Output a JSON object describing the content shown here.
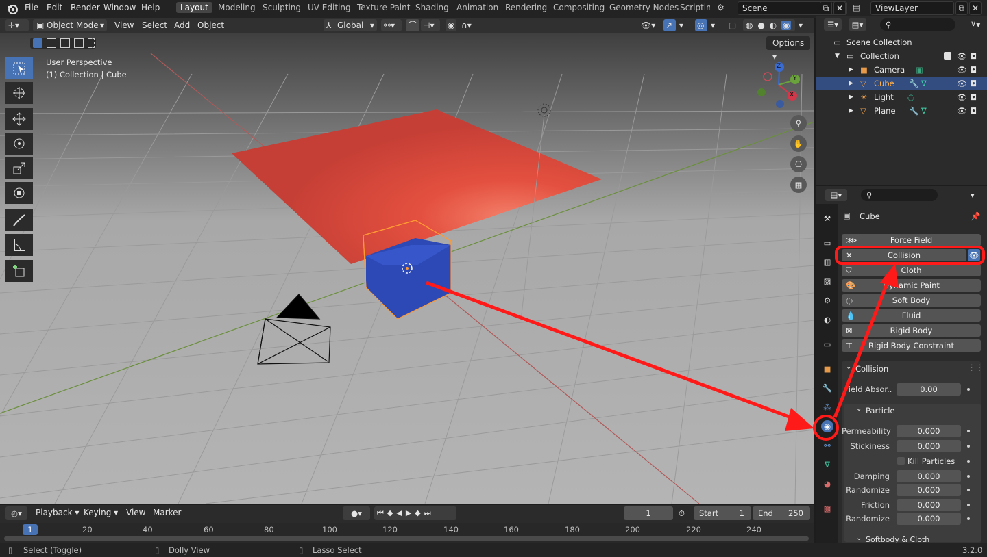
{
  "topbar": {
    "menus": [
      "File",
      "Edit",
      "Render",
      "Window",
      "Help"
    ],
    "workspaces": [
      "Layout",
      "Modeling",
      "Sculpting",
      "UV Editing",
      "Texture Paint",
      "Shading",
      "Animation",
      "Rendering",
      "Compositing",
      "Geometry Nodes",
      "Scripting"
    ],
    "scene": "Scene",
    "view_layer": "ViewLayer"
  },
  "viewport_header": {
    "mode": "Object Mode",
    "menus": [
      "View",
      "Select",
      "Add",
      "Object"
    ],
    "orientation": "Global",
    "options": "Options"
  },
  "viewport": {
    "perspective": "User Perspective",
    "collection_info": "(1) Collection | Cube",
    "gizmo": {
      "x": "X",
      "y": "Y",
      "z": "Z"
    }
  },
  "timeline": {
    "playback": "Playback",
    "keying": "Keying",
    "view": "View",
    "marker": "Marker",
    "current_frame": "1",
    "start_label": "Start",
    "start_value": "1",
    "end_label": "End",
    "end_value": "250",
    "ruler_current": "1",
    "ruler_ticks": [
      "20",
      "40",
      "60",
      "80",
      "100",
      "120",
      "140",
      "160",
      "180",
      "200",
      "220",
      "240"
    ]
  },
  "status": {
    "select": "Select (Toggle)",
    "dolly": "Dolly View",
    "lasso": "Lasso Select",
    "version": "3.2.0"
  },
  "outliner": {
    "scene_collection": "Scene Collection",
    "collection": "Collection",
    "items": [
      {
        "name": "Camera"
      },
      {
        "name": "Cube"
      },
      {
        "name": "Light"
      },
      {
        "name": "Plane"
      }
    ]
  },
  "properties": {
    "object_name": "Cube",
    "physics_buttons": [
      "Force Field",
      "Collision",
      "Cloth",
      "Dynamic Paint",
      "Soft Body",
      "Fluid",
      "Rigid Body",
      "Rigid Body Constraint"
    ],
    "collision_panel": "Collision",
    "field_absorption_label": "Field Absor...",
    "field_absorption": "0.00",
    "particle_panel": "Particle",
    "permeability_label": "Permeability",
    "permeability": "0.000",
    "stickiness_label": "Stickiness",
    "stickiness": "0.000",
    "kill_particles": "Kill Particles",
    "damping_label": "Damping",
    "damping": "0.000",
    "randomize1_label": "Randomize",
    "randomize1": "0.000",
    "friction_label": "Friction",
    "friction": "0.000",
    "randomize2_label": "Randomize",
    "randomize2": "0.000",
    "softbody_panel": "Softbody & Cloth"
  },
  "colors": {
    "accent": "#4772b3",
    "annotation": "#ff1a1a",
    "selected": "#ff9a33"
  }
}
